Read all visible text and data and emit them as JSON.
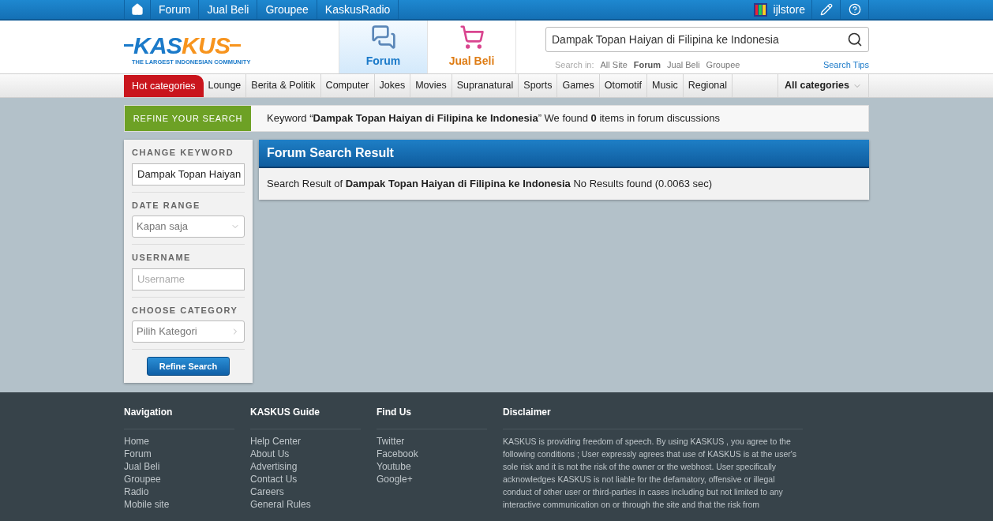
{
  "top_nav": {
    "items": [
      "Forum",
      "Jual Beli",
      "Groupee",
      "KaskusRadio"
    ],
    "username": "ijlstore"
  },
  "logo": {
    "left": "KAS",
    "right": "KUS",
    "tagline": "THE LARGEST INDONESIAN COMMUNITY"
  },
  "sections": [
    {
      "label": "Forum",
      "selected": true,
      "kind": "forum"
    },
    {
      "label": "Jual Beli",
      "selected": false,
      "kind": "cart"
    }
  ],
  "search": {
    "value": "Dampak Topan Haiyan di Filipina ke Indonesia",
    "search_in_label": "Search in:",
    "scopes": [
      {
        "label": "All Site",
        "selected": false
      },
      {
        "label": "Forum",
        "selected": true
      },
      {
        "label": "Jual Beli",
        "selected": false
      },
      {
        "label": "Groupee",
        "selected": false
      }
    ],
    "tips": "Search Tips"
  },
  "categories": {
    "hot": "Hot categories",
    "items": [
      "Lounge",
      "Berita & Politik",
      "Computer",
      "Jokes",
      "Movies",
      "Supranatural",
      "Sports",
      "Games",
      "Otomotif",
      "Music",
      "Regional"
    ],
    "all": "All categories"
  },
  "refine_banner": {
    "label": "REFINE YOUR SEARCH",
    "message": "Keyword “**Dampak Topan Haiyan di Filipina ke Indonesia**” We found **0** items in forum discussions"
  },
  "sidebar": {
    "keyword_label": "CHANGE KEYWORD",
    "keyword_value": "Dampak Topan Haiyan",
    "date_label": "DATE RANGE",
    "date_value": "Kapan saja",
    "username_label": "USERNAME",
    "username_placeholder": "Username",
    "category_label": "CHOOSE CATEGORY",
    "category_value": "Pilih Kategori",
    "button": "Refine Search"
  },
  "result": {
    "title": "Forum Search Result",
    "message": "Search Result of **Dampak Topan Haiyan di Filipina ke Indonesia** No Results found (0.0063 sec)"
  },
  "footer": {
    "columns": [
      {
        "title": "Navigation",
        "links": [
          "Home",
          "Forum",
          "Jual Beli",
          "Groupee",
          "Radio",
          "Mobile site"
        ]
      },
      {
        "title": "KASKUS Guide",
        "links": [
          "Help Center",
          "About Us",
          "Advertising",
          "Contact Us",
          "Careers",
          "General Rules"
        ]
      },
      {
        "title": "Find Us",
        "links": [
          "Twitter",
          "Facebook",
          "Youtube",
          "Google+"
        ]
      }
    ],
    "disclaimer_title": "Disclaimer",
    "disclaimer": "KASKUS is providing freedom of speech. By using KASKUS , you agree to the following conditions ; User expressly agrees that use of KASKUS is at the user's sole risk and it is not the risk of the owner or the webhost. User specifically acknowledges KASKUS is not liable for the defamatory, offensive or illegal conduct of other user or third-parties in cases including but not limited to any interactive communication on or through the site and that the risk from"
  }
}
